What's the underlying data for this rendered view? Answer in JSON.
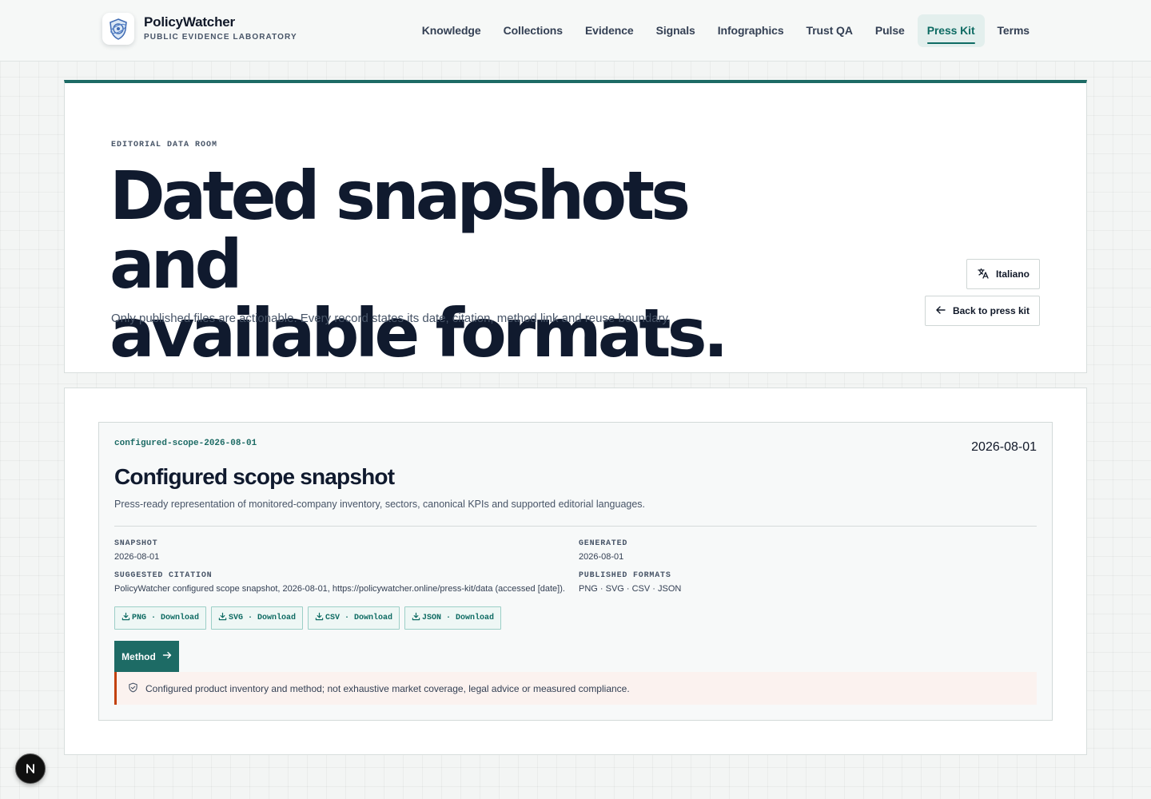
{
  "brand": {
    "name": "PolicyWatcher",
    "subtitle": "PUBLIC EVIDENCE LABORATORY",
    "logo_icon": "shield-globe-icon"
  },
  "nav": {
    "items": [
      {
        "label": "Knowledge"
      },
      {
        "label": "Collections"
      },
      {
        "label": "Evidence"
      },
      {
        "label": "Signals"
      },
      {
        "label": "Infographics"
      },
      {
        "label": "Trust QA"
      },
      {
        "label": "Pulse"
      },
      {
        "label": "Press Kit"
      },
      {
        "label": "Terms"
      }
    ],
    "active": "Press Kit"
  },
  "hero": {
    "eyebrow": "EDITORIAL DATA ROOM",
    "title_line1": "Dated snapshots and",
    "title_line2": "available formats.",
    "description": "Only published files are actionable. Every record states its date, citation, method link and reuse boundary.",
    "language_button": "Italiano",
    "back_button": "Back to press kit"
  },
  "snapshot": {
    "id": "configured-scope-2026-08-01",
    "date": "2026-08-01",
    "title": "Configured scope snapshot",
    "description": "Press-ready representation of monitored-company inventory, sectors, canonical KPIs and supported editorial languages.",
    "meta": {
      "snapshot_label": "SNAPSHOT",
      "snapshot_value": "2026-08-01",
      "generated_label": "GENERATED",
      "generated_value": "2026-08-01",
      "citation_label": "SUGGESTED CITATION",
      "citation_value": "PolicyWatcher configured scope snapshot, 2026-08-01, https://policywatcher.online/press-kit/data (accessed [date]).",
      "formats_label": "PUBLISHED FORMATS",
      "formats_value": "PNG · SVG · CSV · JSON"
    },
    "downloads": [
      {
        "label": "PNG · Download"
      },
      {
        "label": "SVG · Download"
      },
      {
        "label": "CSV · Download"
      },
      {
        "label": "JSON · Download"
      }
    ],
    "method_button": "Method",
    "notice": "Configured product inventory and method; not exhaustive market coverage, legal advice or measured compliance."
  },
  "colors": {
    "accent": "#1d6b65",
    "nav_active_bg": "#e3efed",
    "notice_border": "#c2410c",
    "notice_bg": "#fbf2ef"
  },
  "floating_badge": {
    "letter": "N"
  }
}
